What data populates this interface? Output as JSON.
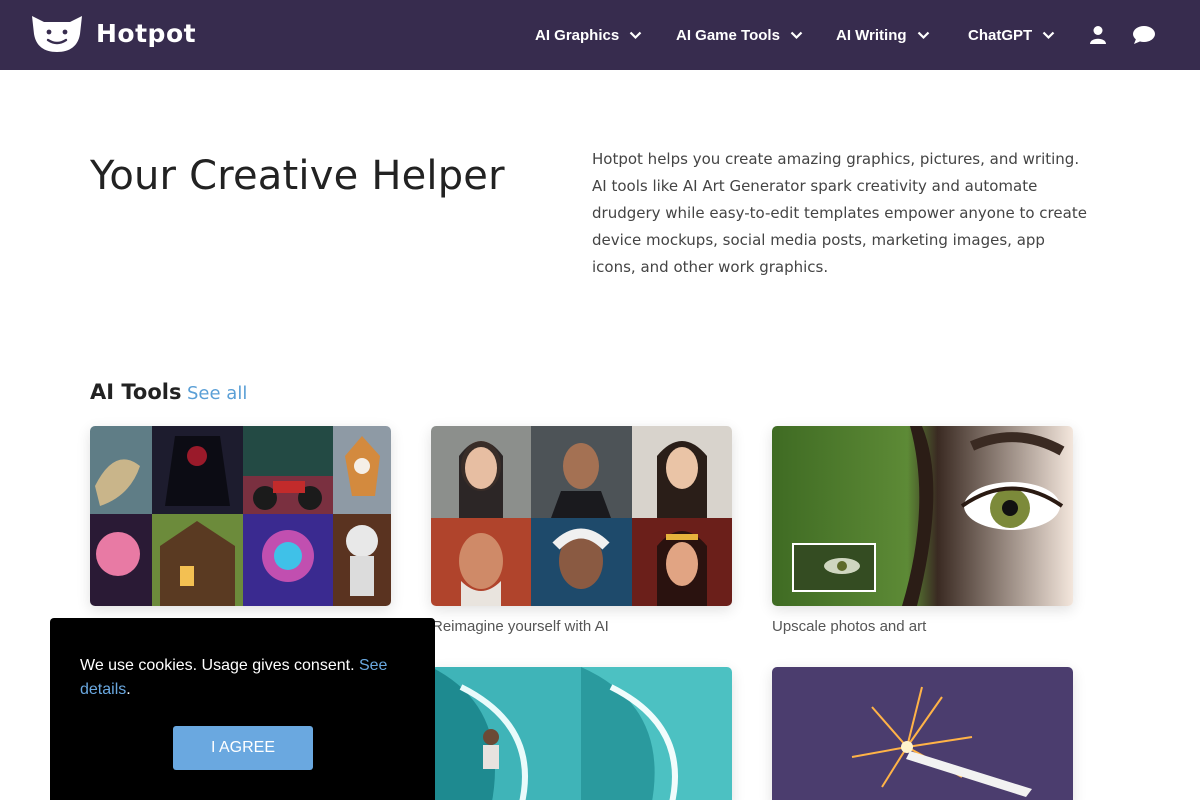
{
  "brand": {
    "name": "Hotpot"
  },
  "nav": {
    "items": [
      {
        "label": "AI Graphics"
      },
      {
        "label": "AI Game Tools"
      },
      {
        "label": "AI Writing"
      },
      {
        "label": "ChatGPT"
      }
    ],
    "icons": [
      "user-icon",
      "chat-icon"
    ]
  },
  "hero": {
    "title": "Your Creative Helper",
    "description": "Hotpot helps you create amazing graphics, pictures, and writing. AI tools like AI Art Generator spark creativity and automate drudgery while easy-to-edit templates empower anyone to create device mockups, social media posts, marketing images, app icons, and other work graphics."
  },
  "ai_tools": {
    "title": "AI Tools",
    "see_all": "See all",
    "cards": [
      {
        "caption": ""
      },
      {
        "caption": "Reimagine yourself with AI"
      },
      {
        "caption": "Upscale photos and art"
      }
    ]
  },
  "cookie": {
    "text": "We use cookies. Usage gives consent.",
    "link": "See details",
    "period": ".",
    "button": "I AGREE"
  },
  "colors": {
    "header_bg": "#372c4e",
    "link": "#5a9fd6",
    "button": "#6aa8e0"
  }
}
